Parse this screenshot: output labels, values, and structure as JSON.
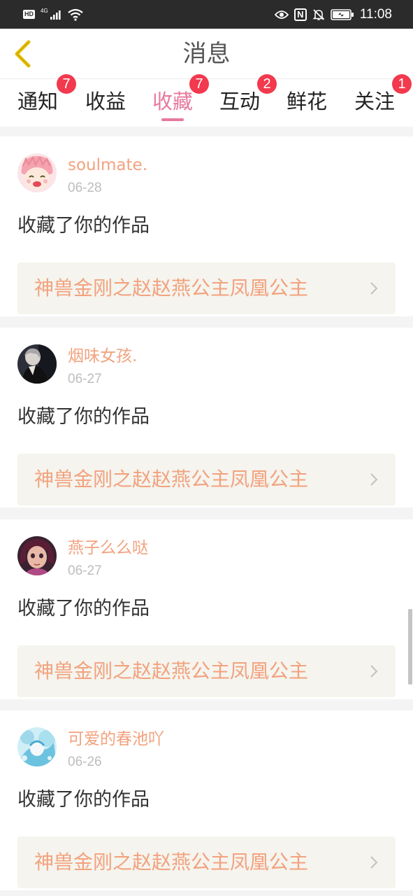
{
  "status_bar": {
    "hd": "HD",
    "network": "4G",
    "nfc": "N",
    "time": "11:08",
    "icons": [
      "hd-icon",
      "signal-icon",
      "wifi-icon",
      "eye-icon",
      "nfc-icon",
      "mute-icon",
      "battery-icon"
    ]
  },
  "nav": {
    "title": "消息",
    "back_icon": "chevron-left-icon",
    "back_color": "#e6c000"
  },
  "tabs": [
    {
      "label": "通知",
      "badge": "7",
      "active": false
    },
    {
      "label": "收益",
      "badge": "",
      "active": false
    },
    {
      "label": "收藏",
      "badge": "7",
      "active": true
    },
    {
      "label": "互动",
      "badge": "2",
      "active": false
    },
    {
      "label": "鲜花",
      "badge": "",
      "active": false
    },
    {
      "label": "关注",
      "badge": "1",
      "active": false
    }
  ],
  "colors": {
    "accent": "#e7799d",
    "badge": "#f2394d",
    "name": "#f2a27e",
    "work_bg": "#f5f4ee"
  },
  "cards": [
    {
      "user": "soulmate.",
      "date": "06-28",
      "action": "收藏了你的作品",
      "work": "神兽金刚之赵赵燕公主凤凰公主"
    },
    {
      "user": "烟味女孩.",
      "date": "06-27",
      "action": "收藏了你的作品",
      "work": "神兽金刚之赵赵燕公主凤凰公主"
    },
    {
      "user": "燕子么么哒",
      "date": "06-27",
      "action": "收藏了你的作品",
      "work": "神兽金刚之赵赵燕公主凤凰公主"
    },
    {
      "user": "可爱的春池吖",
      "date": "06-26",
      "action": "收藏了你的作品",
      "work": "神兽金刚之赵赵燕公主凤凰公主"
    }
  ]
}
